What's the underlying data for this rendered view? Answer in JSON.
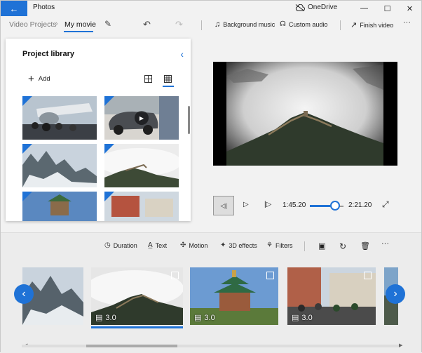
{
  "window": {
    "app_title": "Photos",
    "cloud_label": "OneDrive",
    "controls": {
      "minimize": "—",
      "maximize": "☐",
      "close": "✕"
    }
  },
  "toolbar": {
    "breadcrumb_parent": "Video Projects",
    "breadcrumb_current": "My movie",
    "background_music_label": "Background music",
    "custom_audio_label": "Custom audio",
    "finish_video_label": "Finish video",
    "more_label": "···"
  },
  "library": {
    "title": "Project library",
    "add_label": "Add",
    "view_mode": "small-grid"
  },
  "player": {
    "current_time": "1:45.20",
    "total_time": "2:21.20",
    "progress_fraction": 0.75
  },
  "storyboard": {
    "tools": {
      "duration": "Duration",
      "text": "Text",
      "motion": "Motion",
      "effects_3d": "3D effects",
      "filters": "Filters",
      "more": "···"
    },
    "cards": [
      {
        "duration": ""
      },
      {
        "duration": "3.0",
        "selected": true
      },
      {
        "duration": "3.0"
      },
      {
        "duration": "3.0"
      }
    ]
  },
  "colors": {
    "accent": "#1f72d6"
  },
  "icons": [
    "back-arrow-icon",
    "cloud-off-icon",
    "edit-pencil-icon",
    "undo-icon",
    "redo-icon",
    "music-icon",
    "custom-audio-icon",
    "share-icon",
    "plus-icon",
    "large-grid-icon",
    "small-grid-icon",
    "collapse-chevron-icon",
    "play-icon",
    "rewind-icon",
    "skip-forward-icon",
    "fullscreen-icon",
    "clock-icon",
    "text-icon",
    "motion-icon",
    "3d-effects-icon",
    "filters-icon",
    "crop-icon",
    "rotate-icon",
    "delete-icon",
    "image-icon"
  ]
}
